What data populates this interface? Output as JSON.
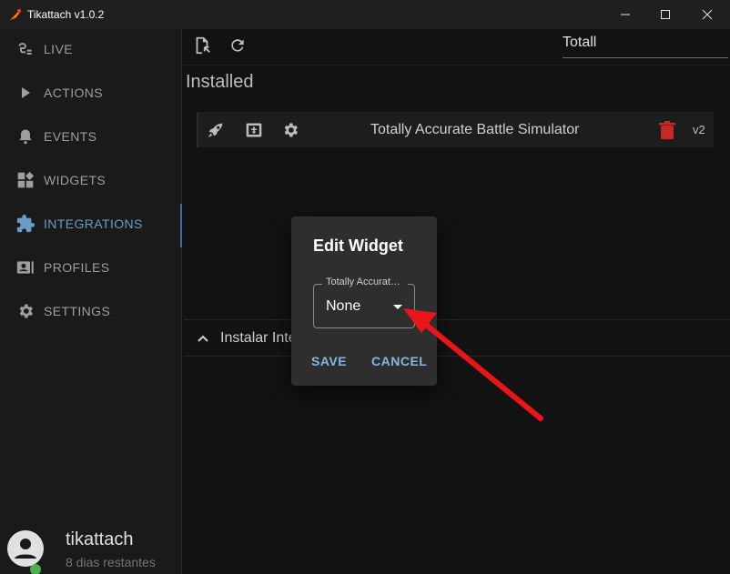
{
  "window": {
    "title": "Tikattach v1.0.2"
  },
  "sidebar": {
    "items": [
      {
        "label": "LIVE",
        "icon": "live-icon"
      },
      {
        "label": "ACTIONS",
        "icon": "play-icon"
      },
      {
        "label": "EVENTS",
        "icon": "bell-icon"
      },
      {
        "label": "WIDGETS",
        "icon": "widgets-icon"
      },
      {
        "label": "INTEGRATIONS",
        "icon": "puzzle-icon",
        "active": true
      },
      {
        "label": "PROFILES",
        "icon": "profile-card-icon"
      },
      {
        "label": "SETTINGS",
        "icon": "gear-icon"
      }
    ],
    "user": {
      "name": "tikattach",
      "days_left": "8 dias restantes"
    }
  },
  "toolbar": {
    "search_value": "Totall"
  },
  "installed": {
    "title": "Installed",
    "items": [
      {
        "name": "Totally Accurate Battle Simulator",
        "version": "v2"
      }
    ]
  },
  "install_section": {
    "label": "Instalar Integrações"
  },
  "dialog": {
    "title": "Edit Widget",
    "select_label": "Totally Accurate Battle Simulator",
    "select_value": "None",
    "save_label": "SAVE",
    "cancel_label": "CANCEL"
  },
  "colors": {
    "accent": "#6b9cc8",
    "delete": "#c62828",
    "annotation_arrow": "#e8161b"
  }
}
